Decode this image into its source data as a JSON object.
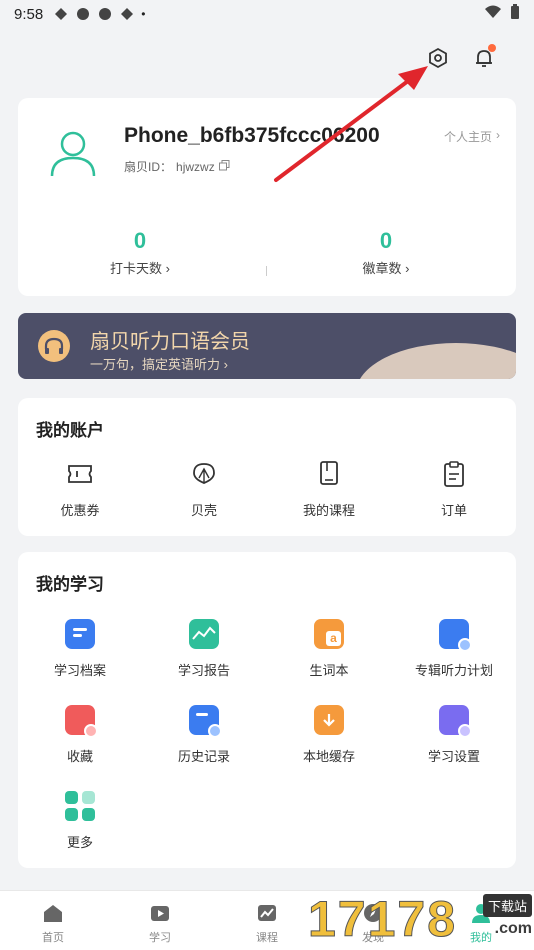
{
  "status_bar": {
    "time": "9:58"
  },
  "profile": {
    "username": "Phone_b6fb375fccc06200",
    "id_label": "扇贝ID：",
    "id_value": "hjwzwz",
    "homepage_label": "个人主页",
    "checkin_count": "0",
    "checkin_label": "打卡天数",
    "badge_count": "0",
    "badge_label": "徽章数"
  },
  "vip": {
    "title": "扇贝听力口语会员",
    "subtitle": "一万句，搞定英语听力"
  },
  "account": {
    "title": "我的账户",
    "items": [
      {
        "label": "优惠券",
        "icon": "coupon-icon"
      },
      {
        "label": "贝壳",
        "icon": "shell-icon"
      },
      {
        "label": "我的课程",
        "icon": "book-icon"
      },
      {
        "label": "订单",
        "icon": "order-icon"
      }
    ]
  },
  "learning": {
    "title": "我的学习",
    "items": [
      {
        "label": "学习档案",
        "icon": "archive-icon",
        "color": "#3b7cf0"
      },
      {
        "label": "学习报告",
        "icon": "report-icon",
        "color": "#2fbf9a"
      },
      {
        "label": "生词本",
        "icon": "vocab-icon",
        "color": "#f59a3c"
      },
      {
        "label": "专辑听力计划",
        "icon": "plan-icon",
        "color": "#3b7cf0"
      },
      {
        "label": "收藏",
        "icon": "favorite-icon",
        "color": "#f05b5b"
      },
      {
        "label": "历史记录",
        "icon": "history-icon",
        "color": "#3b7cf0"
      },
      {
        "label": "本地缓存",
        "icon": "cache-icon",
        "color": "#f59a3c"
      },
      {
        "label": "学习设置",
        "icon": "settings-icon",
        "color": "#7a6cf0"
      },
      {
        "label": "更多",
        "icon": "more-icon",
        "color": "#2fbf9a"
      }
    ]
  },
  "nav": {
    "items": [
      {
        "label": "首页",
        "icon": "home-icon"
      },
      {
        "label": "学习",
        "icon": "play-icon"
      },
      {
        "label": "课程",
        "icon": "chart-icon"
      },
      {
        "label": "发现",
        "icon": "compass-icon"
      },
      {
        "label": "我的",
        "icon": "user-icon"
      }
    ]
  },
  "watermark": {
    "number": "17178",
    "tag": "下载站",
    "domain": ".com"
  },
  "colors": {
    "accent": "#2fbf9a",
    "vip_bg": "#4d4f68",
    "vip_text": "#f2d6ab",
    "arrow": "#e0262c"
  }
}
